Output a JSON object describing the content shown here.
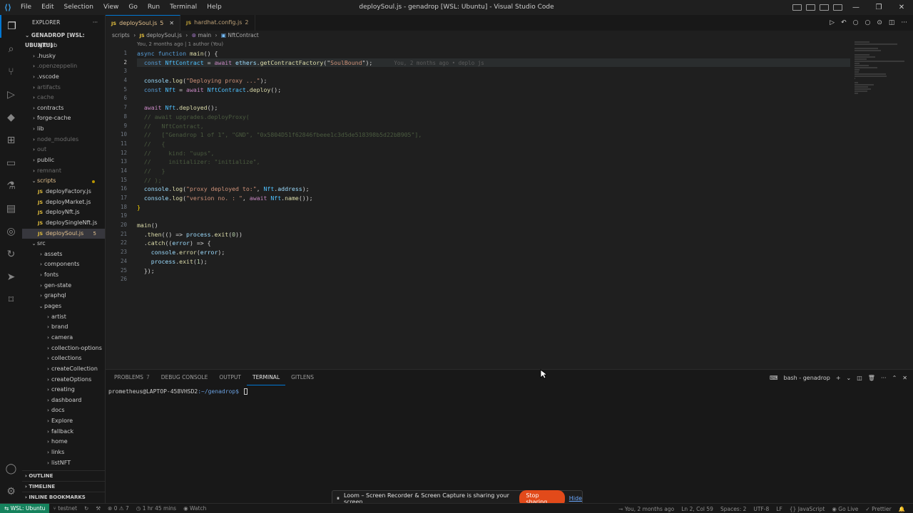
{
  "window": {
    "title": "deploySoul.js - genadrop [WSL: Ubuntu] - Visual Studio Code",
    "menu": [
      "File",
      "Edit",
      "Selection",
      "View",
      "Go",
      "Run",
      "Terminal",
      "Help"
    ]
  },
  "explorer": {
    "header": "EXPLORER",
    "more": "···",
    "root": "GENADROP [WSL: UBUNTU]",
    "items": [
      {
        "label": ".github",
        "level": 0,
        "type": "folder",
        "state": "normal"
      },
      {
        "label": ".husky",
        "level": 0,
        "type": "folder",
        "state": "normal"
      },
      {
        "label": ".openzeppelin",
        "level": 0,
        "type": "folder",
        "state": "dim"
      },
      {
        "label": ".vscode",
        "level": 0,
        "type": "folder",
        "state": "normal"
      },
      {
        "label": "artifacts",
        "level": 0,
        "type": "folder",
        "state": "dim"
      },
      {
        "label": "cache",
        "level": 0,
        "type": "folder",
        "state": "dim"
      },
      {
        "label": "contracts",
        "level": 0,
        "type": "folder",
        "state": "normal"
      },
      {
        "label": "forge-cache",
        "level": 0,
        "type": "folder",
        "state": "normal"
      },
      {
        "label": "lib",
        "level": 0,
        "type": "folder",
        "state": "normal"
      },
      {
        "label": "node_modules",
        "level": 0,
        "type": "folder",
        "state": "dim"
      },
      {
        "label": "out",
        "level": 0,
        "type": "folder",
        "state": "dim"
      },
      {
        "label": "public",
        "level": 0,
        "type": "folder",
        "state": "normal"
      },
      {
        "label": "remnant",
        "level": 0,
        "type": "folder",
        "state": "dim"
      },
      {
        "label": "scripts",
        "level": 0,
        "type": "folder-open",
        "state": "mod"
      },
      {
        "label": "deployFactory.js",
        "level": 1,
        "type": "js",
        "state": "normal"
      },
      {
        "label": "deployMarket.js",
        "level": 1,
        "type": "js",
        "state": "normal"
      },
      {
        "label": "deployNft.js",
        "level": 1,
        "type": "js",
        "state": "normal"
      },
      {
        "label": "deploySingleNft.js",
        "level": 1,
        "type": "js",
        "state": "normal"
      },
      {
        "label": "deploySoul.js",
        "level": 1,
        "type": "js",
        "state": "active",
        "badge": "5"
      },
      {
        "label": "src",
        "level": 0,
        "type": "folder-open",
        "state": "normal"
      },
      {
        "label": "assets",
        "level": 1,
        "type": "folder",
        "state": "normal"
      },
      {
        "label": "components",
        "level": 1,
        "type": "folder",
        "state": "normal"
      },
      {
        "label": "fonts",
        "level": 1,
        "type": "folder",
        "state": "normal"
      },
      {
        "label": "gen-state",
        "level": 1,
        "type": "folder",
        "state": "normal"
      },
      {
        "label": "graphql",
        "level": 1,
        "type": "folder",
        "state": "normal"
      },
      {
        "label": "pages",
        "level": 1,
        "type": "folder-open",
        "state": "normal"
      },
      {
        "label": "artist",
        "level": 2,
        "type": "folder",
        "state": "normal"
      },
      {
        "label": "brand",
        "level": 2,
        "type": "folder",
        "state": "normal"
      },
      {
        "label": "camera",
        "level": 2,
        "type": "folder",
        "state": "normal"
      },
      {
        "label": "collection-options",
        "level": 2,
        "type": "folder",
        "state": "normal"
      },
      {
        "label": "collections",
        "level": 2,
        "type": "folder",
        "state": "normal"
      },
      {
        "label": "createCollection",
        "level": 2,
        "type": "folder",
        "state": "normal"
      },
      {
        "label": "createOptions",
        "level": 2,
        "type": "folder",
        "state": "normal"
      },
      {
        "label": "creating",
        "level": 2,
        "type": "folder",
        "state": "normal"
      },
      {
        "label": "dashboard",
        "level": 2,
        "type": "folder",
        "state": "normal"
      },
      {
        "label": "docs",
        "level": 2,
        "type": "folder",
        "state": "normal"
      },
      {
        "label": "Explore",
        "level": 2,
        "type": "folder",
        "state": "normal"
      },
      {
        "label": "fallback",
        "level": 2,
        "type": "folder",
        "state": "normal"
      },
      {
        "label": "home",
        "level": 2,
        "type": "folder",
        "state": "normal"
      },
      {
        "label": "links",
        "level": 2,
        "type": "folder",
        "state": "normal"
      },
      {
        "label": "listNFT",
        "level": 2,
        "type": "folder",
        "state": "normal"
      }
    ],
    "sections": {
      "outline": "OUTLINE",
      "timeline": "TIMELINE",
      "bookmarks": "INLINE BOOKMARKS"
    }
  },
  "tabs": [
    {
      "label": "deploySoul.js",
      "badge": "5",
      "active": true
    },
    {
      "label": "hardhat.config.js",
      "badge": "2",
      "active": false
    }
  ],
  "breadcrumb": [
    "scripts",
    "deploySoul.js",
    "main",
    "NftContract"
  ],
  "editor": {
    "blame_header": "You, 2 months ago | 1 author (You)",
    "inline_blame": "You, 2 months ago • deplo js",
    "current_line": 2,
    "lines": [
      [
        {
          "t": "async function ",
          "c": "#569cd6"
        },
        {
          "t": "main",
          "c": "#dcdcaa"
        },
        {
          "t": "() {",
          "c": "#d4d4d4"
        }
      ],
      [
        {
          "t": "  const ",
          "c": "#569cd6"
        },
        {
          "t": "NftContract",
          "c": "#4fc1ff"
        },
        {
          "t": " = ",
          "c": "#d4d4d4"
        },
        {
          "t": "await ",
          "c": "#c586c0"
        },
        {
          "t": "ethers",
          "c": "#9cdcfe"
        },
        {
          "t": ".",
          "c": "#d4d4d4"
        },
        {
          "t": "getContractFactory",
          "c": "#dcdcaa"
        },
        {
          "t": "(\"",
          "c": "#d4d4d4"
        },
        {
          "t": "SoulBound",
          "c": "#ce9178"
        },
        {
          "t": "\");",
          "c": "#d4d4d4"
        }
      ],
      [],
      [
        {
          "t": "  console",
          "c": "#9cdcfe"
        },
        {
          "t": ".",
          "c": "#d4d4d4"
        },
        {
          "t": "log",
          "c": "#dcdcaa"
        },
        {
          "t": "(",
          "c": "#d4d4d4"
        },
        {
          "t": "\"Deploying proxy ...\"",
          "c": "#ce9178"
        },
        {
          "t": ");",
          "c": "#d4d4d4"
        }
      ],
      [
        {
          "t": "  const ",
          "c": "#569cd6"
        },
        {
          "t": "Nft",
          "c": "#4fc1ff"
        },
        {
          "t": " = ",
          "c": "#d4d4d4"
        },
        {
          "t": "await ",
          "c": "#c586c0"
        },
        {
          "t": "NftContract",
          "c": "#4fc1ff"
        },
        {
          "t": ".",
          "c": "#d4d4d4"
        },
        {
          "t": "deploy",
          "c": "#dcdcaa"
        },
        {
          "t": "();",
          "c": "#d4d4d4"
        }
      ],
      [],
      [
        {
          "t": "  await ",
          "c": "#c586c0"
        },
        {
          "t": "Nft",
          "c": "#4fc1ff"
        },
        {
          "t": ".",
          "c": "#d4d4d4"
        },
        {
          "t": "deployed",
          "c": "#dcdcaa"
        },
        {
          "t": "();",
          "c": "#d4d4d4"
        }
      ],
      [
        {
          "t": "  // await upgrades.deployProxy(",
          "c": "#4a5a3f"
        }
      ],
      [
        {
          "t": "  //   NftContract,",
          "c": "#4a5a3f"
        }
      ],
      [
        {
          "t": "  //   [\"Genadrop 1 of 1\", \"GND\", \"0x5804D51f62846fbeee1c3d5de518398b5d22bB905\"],",
          "c": "#4a5a3f"
        }
      ],
      [
        {
          "t": "  //   {",
          "c": "#4a5a3f"
        }
      ],
      [
        {
          "t": "  //     kind: \"uups\",",
          "c": "#4a5a3f"
        }
      ],
      [
        {
          "t": "  //     initializer: \"initialize\",",
          "c": "#4a5a3f"
        }
      ],
      [
        {
          "t": "  //   }",
          "c": "#4a5a3f"
        }
      ],
      [
        {
          "t": "  // );",
          "c": "#4a5a3f"
        }
      ],
      [
        {
          "t": "  console",
          "c": "#9cdcfe"
        },
        {
          "t": ".",
          "c": "#d4d4d4"
        },
        {
          "t": "log",
          "c": "#dcdcaa"
        },
        {
          "t": "(",
          "c": "#d4d4d4"
        },
        {
          "t": "\"proxy deployed to:\"",
          "c": "#ce9178"
        },
        {
          "t": ", ",
          "c": "#d4d4d4"
        },
        {
          "t": "Nft",
          "c": "#4fc1ff"
        },
        {
          "t": ".",
          "c": "#d4d4d4"
        },
        {
          "t": "address",
          "c": "#9cdcfe"
        },
        {
          "t": ");",
          "c": "#d4d4d4"
        }
      ],
      [
        {
          "t": "  console",
          "c": "#9cdcfe"
        },
        {
          "t": ".",
          "c": "#d4d4d4"
        },
        {
          "t": "log",
          "c": "#dcdcaa"
        },
        {
          "t": "(",
          "c": "#d4d4d4"
        },
        {
          "t": "\"version no. : \"",
          "c": "#ce9178"
        },
        {
          "t": ", ",
          "c": "#d4d4d4"
        },
        {
          "t": "await ",
          "c": "#c586c0"
        },
        {
          "t": "Nft",
          "c": "#4fc1ff"
        },
        {
          "t": ".",
          "c": "#d4d4d4"
        },
        {
          "t": "name",
          "c": "#dcdcaa"
        },
        {
          "t": "());",
          "c": "#d4d4d4"
        }
      ],
      [
        {
          "t": "}",
          "c": "#ffd700"
        }
      ],
      [],
      [
        {
          "t": "main",
          "c": "#dcdcaa"
        },
        {
          "t": "()",
          "c": "#d4d4d4"
        }
      ],
      [
        {
          "t": "  .",
          "c": "#d4d4d4"
        },
        {
          "t": "then",
          "c": "#dcdcaa"
        },
        {
          "t": "(() => ",
          "c": "#d4d4d4"
        },
        {
          "t": "process",
          "c": "#9cdcfe"
        },
        {
          "t": ".",
          "c": "#d4d4d4"
        },
        {
          "t": "exit",
          "c": "#dcdcaa"
        },
        {
          "t": "(",
          "c": "#d4d4d4"
        },
        {
          "t": "0",
          "c": "#b5cea8"
        },
        {
          "t": "))",
          "c": "#d4d4d4"
        }
      ],
      [
        {
          "t": "  .",
          "c": "#d4d4d4"
        },
        {
          "t": "catch",
          "c": "#dcdcaa"
        },
        {
          "t": "((",
          "c": "#d4d4d4"
        },
        {
          "t": "error",
          "c": "#9cdcfe"
        },
        {
          "t": ") => {",
          "c": "#d4d4d4"
        }
      ],
      [
        {
          "t": "    console",
          "c": "#9cdcfe"
        },
        {
          "t": ".",
          "c": "#d4d4d4"
        },
        {
          "t": "error",
          "c": "#dcdcaa"
        },
        {
          "t": "(",
          "c": "#d4d4d4"
        },
        {
          "t": "error",
          "c": "#9cdcfe"
        },
        {
          "t": ");",
          "c": "#d4d4d4"
        }
      ],
      [
        {
          "t": "    process",
          "c": "#9cdcfe"
        },
        {
          "t": ".",
          "c": "#d4d4d4"
        },
        {
          "t": "exit",
          "c": "#dcdcaa"
        },
        {
          "t": "(",
          "c": "#d4d4d4"
        },
        {
          "t": "1",
          "c": "#b5cea8"
        },
        {
          "t": ");",
          "c": "#d4d4d4"
        }
      ],
      [
        {
          "t": "  });",
          "c": "#d4d4d4"
        }
      ],
      []
    ]
  },
  "panel": {
    "tabs": [
      {
        "label": "PROBLEMS",
        "count": "7",
        "active": false
      },
      {
        "label": "DEBUG CONSOLE",
        "active": false
      },
      {
        "label": "OUTPUT",
        "active": false
      },
      {
        "label": "TERMINAL",
        "active": true
      },
      {
        "label": "GITLENS",
        "active": false
      }
    ],
    "terminal_name": "bash - genadrop",
    "prompt_user": "prometheus@LAPTOP-458VHSD2",
    "prompt_path": ":~/genadrop$"
  },
  "loom": {
    "message": "Loom – Screen Recorder & Screen Capture is sharing your screen.",
    "stop": "Stop sharing",
    "hide": "Hide"
  },
  "statusbar": {
    "remote": "WSL: Ubuntu",
    "branch": "testnet",
    "problems": "⊗ 0 ⚠ 7",
    "time": "1 hr 45 mins",
    "watch": "Watch",
    "blame": "You, 2 months ago",
    "position": "Ln 2, Col 59",
    "spaces": "Spaces: 2",
    "encoding": "UTF-8",
    "eol": "LF",
    "language": "JavaScript",
    "golive": "Go Live",
    "prettier": "Prettier"
  }
}
